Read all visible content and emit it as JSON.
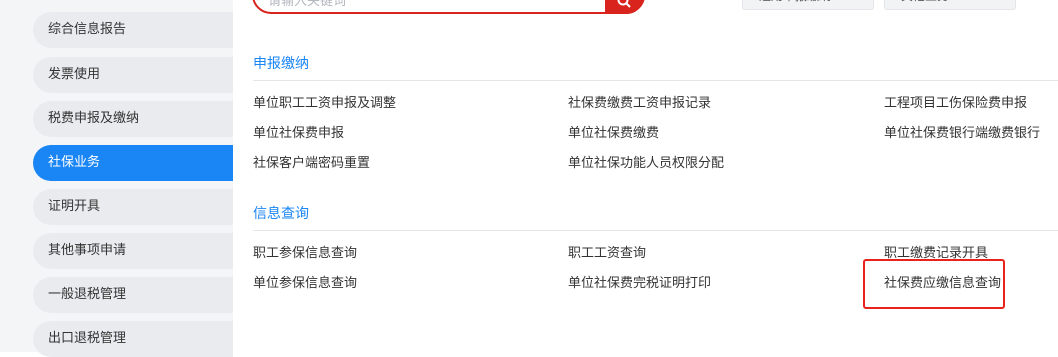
{
  "sidebar": {
    "items": [
      {
        "label": "综合信息报告"
      },
      {
        "label": "发票使用"
      },
      {
        "label": "税费申报及缴纳"
      },
      {
        "label": "社保业务",
        "active": true
      },
      {
        "label": "证明开具"
      },
      {
        "label": "其他事项申请"
      },
      {
        "label": "一般退税管理"
      },
      {
        "label": "出口退税管理"
      }
    ]
  },
  "search": {
    "placeholder": "请输入关键词"
  },
  "top_buttons": [
    {
      "label": "通用申报缴纳"
    },
    {
      "label": "其他业务"
    }
  ],
  "sections": [
    {
      "title": "申报缴纳",
      "links": [
        "单位职工工资申报及调整",
        "社保费缴费工资申报记录",
        "工程项目工伤保险费申报",
        "单位社保费申报",
        "单位社保费缴费",
        "单位社保费银行端缴费银行",
        "社保客户端密码重置",
        "单位社保功能人员权限分配"
      ]
    },
    {
      "title": "信息查询",
      "links": [
        "职工参保信息查询",
        "职工工资查询",
        "职工缴费记录开具",
        "单位参保信息查询",
        "单位社保费完税证明打印",
        "社保费应缴信息查询"
      ]
    }
  ],
  "colors": {
    "accent": "#1a86f5",
    "highlight": "#e8231c",
    "sidebar_bg": "#f4f5f7",
    "item_bg": "#e9ebee"
  }
}
